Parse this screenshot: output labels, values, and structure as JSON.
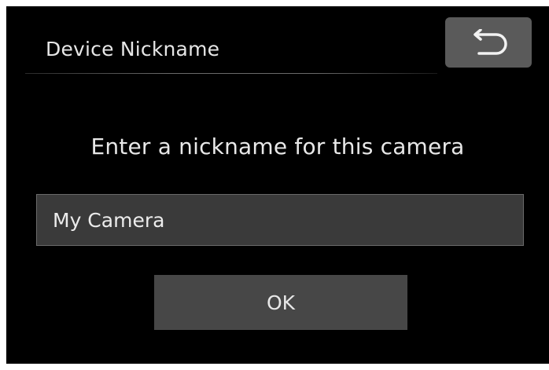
{
  "header": {
    "title": "Device Nickname",
    "back_icon": "return-arrow-icon"
  },
  "main": {
    "prompt": "Enter a nickname for this camera",
    "nickname_field": {
      "value": "My Camera"
    },
    "ok_label": "OK"
  },
  "colors": {
    "background": "#000000",
    "button": "#474747",
    "back_button": "#5a5a5a",
    "field": "#3a3a3a",
    "text": "#e8e8e8"
  }
}
